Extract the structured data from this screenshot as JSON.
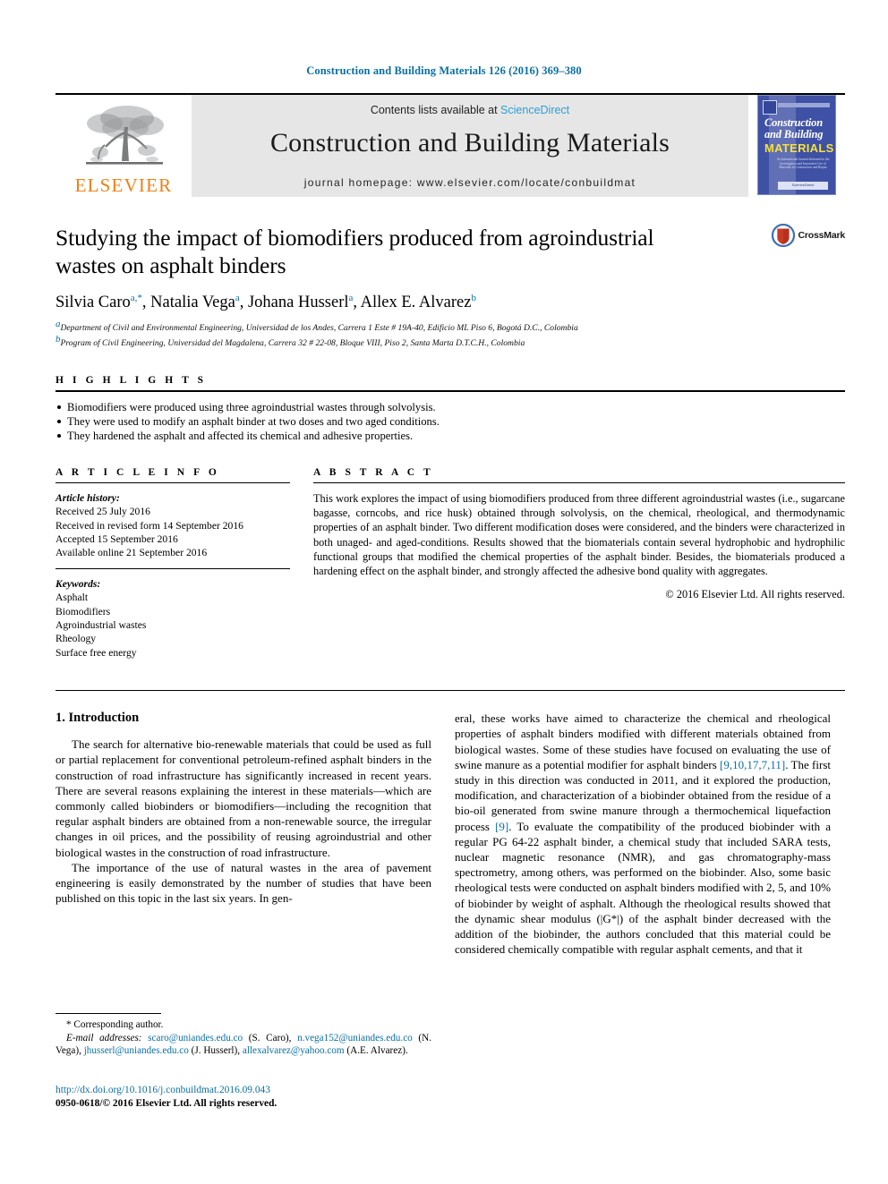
{
  "running_head": "Construction and Building Materials 126 (2016) 369–380",
  "masthead": {
    "publisher": "ELSEVIER",
    "contents_prefix": "Contents lists available at ",
    "contents_link": "ScienceDirect",
    "journal_title": "Construction and Building Materials",
    "homepage": "journal homepage: www.elsevier.com/locate/conbuildmat",
    "cover": {
      "line1": "Construction",
      "line2": "and Building",
      "line3": "MATERIALS",
      "blurb": "An International Journal dedicated to the Investigation and Innovative Use of Materials in Construction and Repair",
      "foot": "ScienceDirect"
    }
  },
  "article": {
    "title": "Studying the impact of biomodifiers produced from agroindustrial wastes on asphalt binders",
    "crossmark_label": "CrossMark",
    "authors": [
      {
        "name": "Silvia Caro",
        "marks": "a,*"
      },
      {
        "name": "Natalia Vega",
        "marks": "a"
      },
      {
        "name": "Johana Husserl",
        "marks": "a"
      },
      {
        "name": "Allex E. Alvarez",
        "marks": "b"
      }
    ],
    "affiliations": [
      {
        "mark": "a",
        "text": "Department of Civil and Environmental Engineering, Universidad de los Andes, Carrera 1 Este # 19A-40, Edificio ML Piso 6, Bogotá D.C., Colombia"
      },
      {
        "mark": "b",
        "text": "Program of Civil Engineering, Universidad del Magdalena, Carrera 32 # 22-08, Bloque VIII, Piso 2, Santa Marta D.T.C.H., Colombia"
      }
    ]
  },
  "highlights": {
    "label": "H I G H L I G H T S",
    "items": [
      "Biomodifiers were produced using three agroindustrial wastes through solvolysis.",
      "They were used to modify an asphalt binder at two doses and two aged conditions.",
      "They hardened the asphalt and affected its chemical and adhesive properties."
    ]
  },
  "article_info": {
    "label": "A R T I C L E   I N F O",
    "history_label": "Article history:",
    "history": [
      "Received 25 July 2016",
      "Received in revised form 14 September 2016",
      "Accepted 15 September 2016",
      "Available online 21 September 2016"
    ],
    "keywords_label": "Keywords:",
    "keywords": [
      "Asphalt",
      "Biomodifiers",
      "Agroindustrial wastes",
      "Rheology",
      "Surface free energy"
    ]
  },
  "abstract": {
    "label": "A B S T R A C T",
    "text": "This work explores the impact of using biomodifiers produced from three different agroindustrial wastes (i.e., sugarcane bagasse, corncobs, and rice husk) obtained through solvolysis, on the chemical, rheological, and thermodynamic properties of an asphalt binder. Two different modification doses were considered, and the binders were characterized in both unaged- and aged-conditions. Results showed that the biomaterials contain several hydrophobic and hydrophilic functional groups that modified the chemical properties of the asphalt binder. Besides, the biomaterials produced a hardening effect on the asphalt binder, and strongly affected the adhesive bond quality with aggregates.",
    "copyright": "© 2016 Elsevier Ltd. All rights reserved."
  },
  "introduction": {
    "heading": "1. Introduction",
    "left_paragraphs": [
      "The search for alternative bio-renewable materials that could be used as full or partial replacement for conventional petroleum-refined asphalt binders in the construction of road infrastructure has significantly increased in recent years. There are several reasons explaining the interest in these materials—which are commonly called biobinders or biomodifiers—including the recognition that regular asphalt binders are obtained from a non-renewable source, the irregular changes in oil prices, and the possibility of reusing agroindustrial and other biological wastes in the construction of road infrastructure.",
      "The importance of the use of natural wastes in the area of pavement engineering is easily demonstrated by the number of studies that have been published on this topic in the last six years. In gen-"
    ],
    "right_paragraph_parts": [
      "eral, these works have aimed to characterize the chemical and rheological properties of asphalt binders modified with different materials obtained from biological wastes. Some of these studies have focused on evaluating the use of swine manure as a potential modifier for asphalt binders ",
      "[9,10,17,7,11]",
      ". The first study in this direction was conducted in 2011, and it explored the production, modification, and characterization of a biobinder obtained from the residue of a bio-oil generated from swine manure through a thermochemical liquefaction process ",
      "[9]",
      ". To evaluate the compatibility of the produced biobinder with a regular PG 64-22 asphalt binder, a chemical study that included SARA tests, nuclear magnetic resonance (NMR), and gas chromatography-mass spectrometry, among others, was performed on the biobinder. Also, some basic rheological tests were conducted on asphalt binders modified with 2, 5, and 10% of biobinder by weight of asphalt. Although the rheological results showed that the dynamic shear modulus (|G*|) of the asphalt binder decreased with the addition of the biobinder, the authors concluded that this material could be considered chemically compatible with regular asphalt cements, and that it"
    ]
  },
  "footnotes": {
    "corresponding": "* Corresponding author.",
    "email_label": "E-mail addresses:",
    "emails": [
      {
        "address": "scaro@uniandes.edu.co",
        "person": "(S. Caro)"
      },
      {
        "address": "n.vega152@uniandes.edu.co",
        "person": "(N. Vega)"
      },
      {
        "address": "jhusserl@uniandes.edu.co",
        "person": "(J. Husserl)"
      },
      {
        "address": "allexalvarez@yahoo.com",
        "person": "(A.E. Alvarez)"
      }
    ]
  },
  "doi_block": {
    "doi": "http://dx.doi.org/10.1016/j.conbuildmat.2016.09.043",
    "issn_line": "0950-0618/© 2016 Elsevier Ltd. All rights reserved."
  },
  "colors": {
    "link": "#0b6fa4",
    "sciencedirect": "#2a9fd6",
    "elsevier_orange": "#f07f13",
    "cover_blue": "#3f51a5"
  }
}
